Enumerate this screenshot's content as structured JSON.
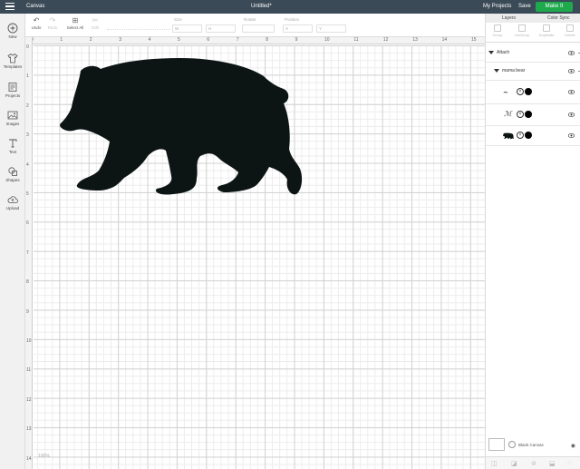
{
  "topbar": {
    "app_name": "Canvas",
    "doc_title": "Untitled*",
    "my_projects": "My Projects",
    "save": "Save",
    "make_it": "Make It"
  },
  "toolbar": {
    "undo": "Undo",
    "redo": "Redo",
    "select_all": "Select All",
    "edit": "Edit",
    "size_label": "Size",
    "rotate_label": "Rotate",
    "position_label": "Position",
    "size_w": "W",
    "size_h": "H",
    "pos_x": "X",
    "pos_y": "Y"
  },
  "leftnav": {
    "items": [
      {
        "label": "New",
        "icon": "plus-circle-icon"
      },
      {
        "label": "Templates",
        "icon": "tshirt-icon"
      },
      {
        "label": "Projects",
        "icon": "projects-icon"
      },
      {
        "label": "Images",
        "icon": "image-icon"
      },
      {
        "label": "Text",
        "icon": "text-icon"
      },
      {
        "label": "Shapes",
        "icon": "shapes-icon"
      },
      {
        "label": "Upload",
        "icon": "upload-icon"
      }
    ]
  },
  "ruler": {
    "top": [
      "0",
      "1",
      "2",
      "3",
      "4",
      "5",
      "6",
      "7",
      "8",
      "9",
      "10",
      "11",
      "12",
      "13",
      "14",
      "15"
    ],
    "left": [
      "0",
      "1",
      "2",
      "3",
      "4",
      "5",
      "6",
      "7",
      "8",
      "9",
      "10",
      "11",
      "12",
      "13",
      "14"
    ]
  },
  "canvas": {
    "zoom": "100%"
  },
  "rightpanel": {
    "tabs": [
      "Layers",
      "Color Sync"
    ],
    "actions": [
      "Group",
      "UnGroup",
      "Duplicate",
      "Delete"
    ],
    "attach": "Attach",
    "group_name": "mama bear",
    "blank_canvas": "Blank Canvas"
  },
  "colors": {
    "topbar": "#3b4a57",
    "make_it": "#1fa94d",
    "bear": "#0c1414"
  }
}
